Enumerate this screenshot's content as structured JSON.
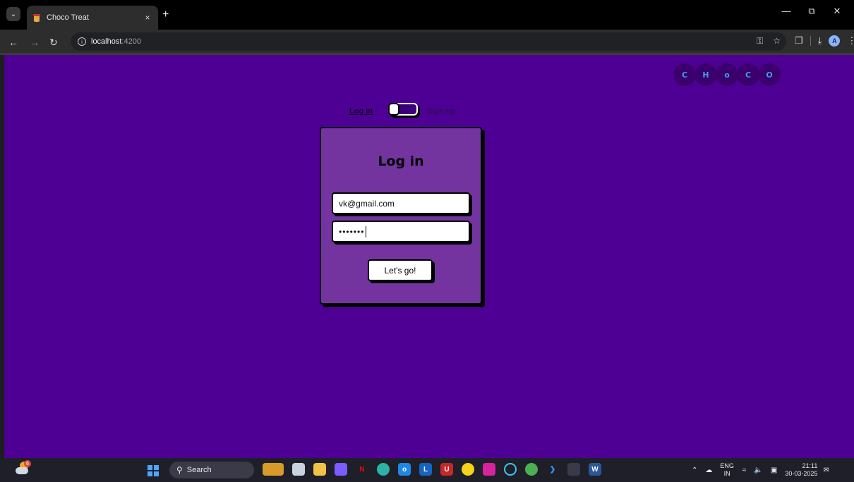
{
  "browser": {
    "tab_title": "Choco Treat",
    "new_tab_symbol": "+",
    "close_symbol": "×",
    "url_host": "localhost",
    "url_port": ":4200"
  },
  "page": {
    "background_color": "#4e0094",
    "logo_letters": [
      "C",
      "H",
      "o",
      "C",
      "O"
    ],
    "switch": {
      "login_label": "Log in",
      "signup_label": "Sign up",
      "mode": "login"
    },
    "card": {
      "title": "Log in",
      "email_value": "vk@gmail.com",
      "password_masked": "•••••••",
      "submit_label": "Let's go!"
    }
  },
  "taskbar": {
    "weather_badge": "6",
    "search_label": "Search",
    "language_top": "ENG",
    "language_bottom": "IN",
    "time": "21:11",
    "date": "30-03-2025"
  },
  "icons": {
    "back": "arrow-left-icon",
    "forward": "arrow-right-icon",
    "reload": "reload-icon",
    "site_info": "info-icon",
    "password_key": "key-icon",
    "bookmark": "star-icon",
    "extensions": "puzzle-icon",
    "downloads": "download-icon",
    "menu": "kebab-icon"
  }
}
